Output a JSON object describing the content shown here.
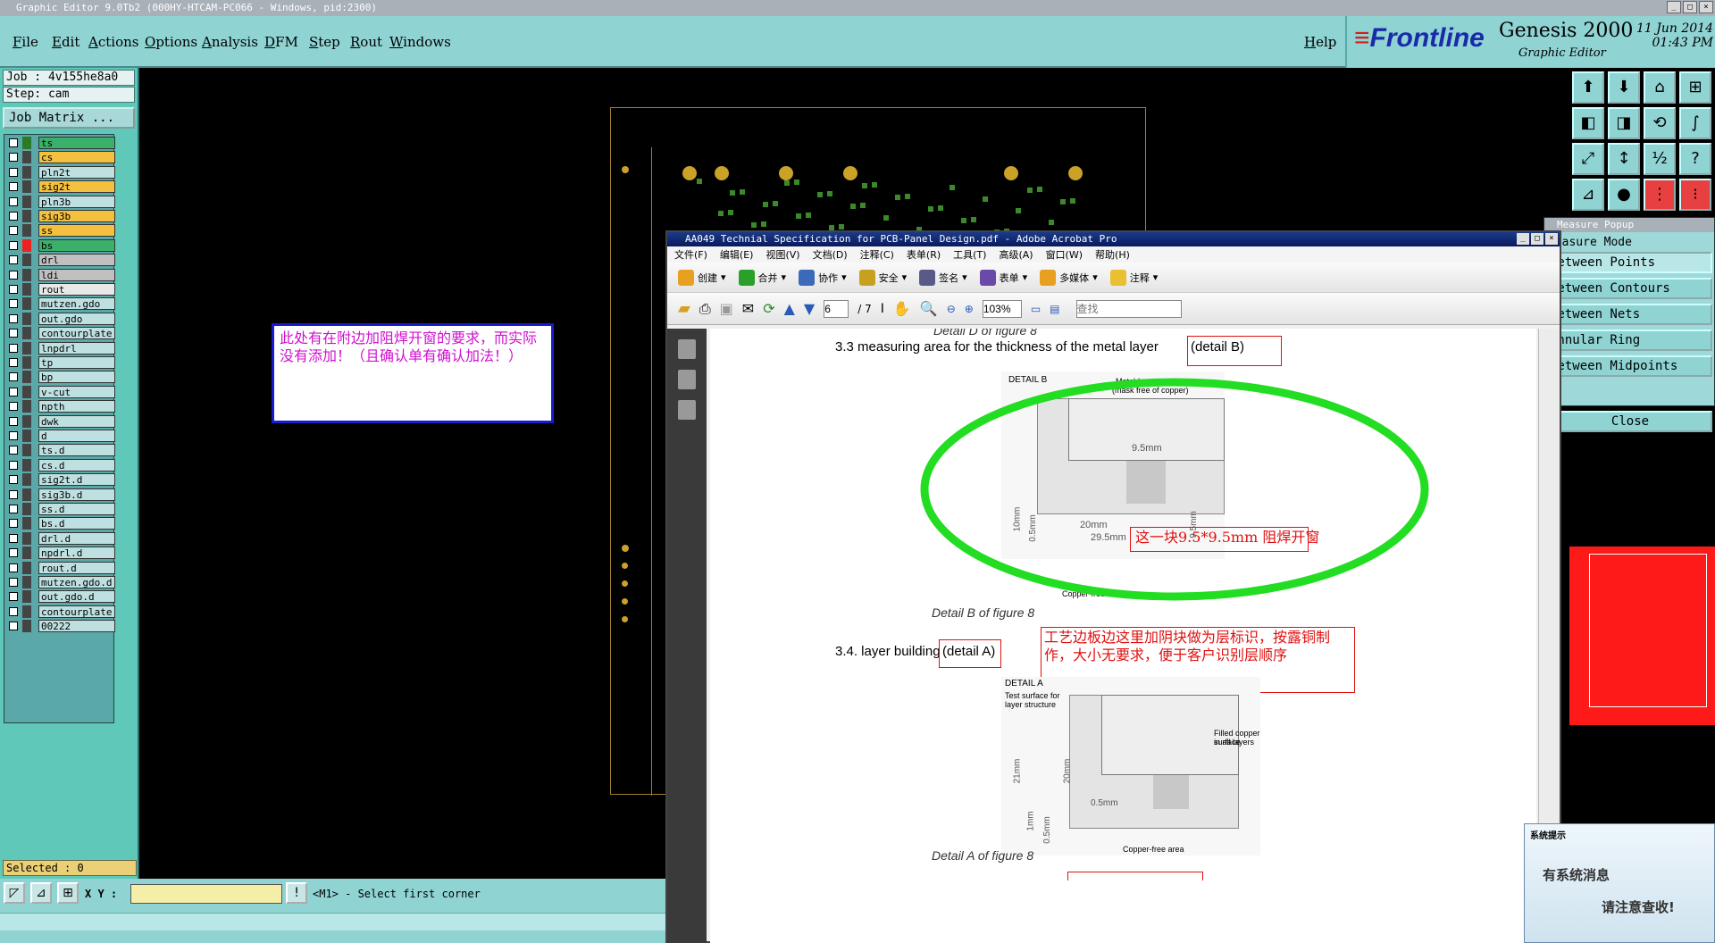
{
  "window": {
    "title": "Graphic Editor 9.0Tb2 (000HY-HTCAM-PC066 - Windows, pid:2300)"
  },
  "menu": [
    "File",
    "Edit",
    "Actions",
    "Options",
    "Analysis",
    "DFM",
    "Step",
    "Rout",
    "Windows"
  ],
  "help": "Help",
  "brand": {
    "logo": "Frontline",
    "product": "Genesis 2000",
    "subtitle": "Graphic Editor",
    "date": "11 Jun 2014",
    "time": "01:43 PM"
  },
  "job": {
    "job": "Job : 4v155he8a0",
    "step": "Step: cam",
    "matrix_button": "Job Matrix ..."
  },
  "layers": [
    {
      "name": "ts",
      "color": "#3ab06a",
      "swatch": "#2a7a2a"
    },
    {
      "name": "cs",
      "color": "#f4c040",
      "swatch": "#444"
    },
    {
      "name": "pln2t",
      "color": "#bfe0e0",
      "swatch": "#444"
    },
    {
      "name": "sig2t",
      "color": "#f4c040",
      "swatch": "#444"
    },
    {
      "name": "pln3b",
      "color": "#bfe0e0",
      "swatch": "#444"
    },
    {
      "name": "sig3b",
      "color": "#f4c040",
      "swatch": "#444"
    },
    {
      "name": "ss",
      "color": "#f4c040",
      "swatch": "#444"
    },
    {
      "name": "bs",
      "color": "#3ab06a",
      "swatch": "#ee2020"
    },
    {
      "name": "drl",
      "color": "#c0c0c0",
      "swatch": "#444"
    },
    {
      "name": "ldi",
      "color": "#c0c0c0",
      "swatch": "#444"
    },
    {
      "name": "rout",
      "color": "#e8e8e8",
      "swatch": "#444"
    },
    {
      "name": "mutzen.gdo",
      "color": "#bfe0e0",
      "swatch": "#444"
    },
    {
      "name": "out.gdo",
      "color": "#bfe0e0",
      "swatch": "#444"
    },
    {
      "name": "contourplate",
      "color": "#bfe0e0",
      "swatch": "#444"
    },
    {
      "name": "lnpdrl",
      "color": "#bfe0e0",
      "swatch": "#444"
    },
    {
      "name": "tp",
      "color": "#bfe0e0",
      "swatch": "#444"
    },
    {
      "name": "bp",
      "color": "#bfe0e0",
      "swatch": "#444"
    },
    {
      "name": "v-cut",
      "color": "#bfe0e0",
      "swatch": "#444"
    },
    {
      "name": "npth",
      "color": "#bfe0e0",
      "swatch": "#444"
    },
    {
      "name": "dwk",
      "color": "#bfe0e0",
      "swatch": "#444"
    },
    {
      "name": "d",
      "color": "#bfe0e0",
      "swatch": "#444"
    },
    {
      "name": "ts.d",
      "color": "#bfe0e0",
      "swatch": "#444"
    },
    {
      "name": "cs.d",
      "color": "#bfe0e0",
      "swatch": "#444"
    },
    {
      "name": "sig2t.d",
      "color": "#bfe0e0",
      "swatch": "#444"
    },
    {
      "name": "sig3b.d",
      "color": "#bfe0e0",
      "swatch": "#444"
    },
    {
      "name": "ss.d",
      "color": "#bfe0e0",
      "swatch": "#444"
    },
    {
      "name": "bs.d",
      "color": "#bfe0e0",
      "swatch": "#444"
    },
    {
      "name": "drl.d",
      "color": "#bfe0e0",
      "swatch": "#444"
    },
    {
      "name": "npdrl.d",
      "color": "#bfe0e0",
      "swatch": "#444"
    },
    {
      "name": "rout.d",
      "color": "#bfe0e0",
      "swatch": "#444"
    },
    {
      "name": "mutzen.gdo.d",
      "color": "#bfe0e0",
      "swatch": "#444"
    },
    {
      "name": "out.gdo.d",
      "color": "#bfe0e0",
      "swatch": "#444"
    },
    {
      "name": "contourplate.",
      "color": "#bfe0e0",
      "swatch": "#444"
    },
    {
      "name": "00222",
      "color": "#bfe0e0",
      "swatch": "#444"
    }
  ],
  "selected": "Selected : 0",
  "xy_label": "X Y :",
  "prompt": "<M1> - Select first corner",
  "canvas_note": "此处有在附边加阻焊开窗的要求，而实际没有添加！（且确认单有确认加法！）",
  "acrobat": {
    "title": "AA049 Technial Specification for PCB-Panel Design.pdf - Adobe Acrobat Pro",
    "menu": [
      "文件(F)",
      "编辑(E)",
      "视图(V)",
      "文档(D)",
      "注释(C)",
      "表单(R)",
      "工具(T)",
      "高级(A)",
      "窗口(W)",
      "帮助(H)"
    ],
    "toolbar": [
      "创建",
      "合并",
      "协作",
      "安全",
      "签名",
      "表单",
      "多媒体",
      "注释"
    ],
    "page": "6",
    "pages": "/ 7",
    "zoom": "103%",
    "search_placeholder": "查找"
  },
  "doc": {
    "caption_d": "Detail D of figure 8",
    "h33": "3.3 measuring area for the thickness of the metal layer",
    "h33_detail": "(detail B)",
    "detail_b": "DETAIL B",
    "coupon": "Metal-layer-coupon",
    "coupon2": "(mask free of copper)",
    "d95": "9.5mm",
    "d20": "20mm",
    "d295": "29.5mm",
    "d10": "10mm",
    "d05": "0.5mm",
    "d95v": "9.5mm",
    "copper_free": "Copper-free area",
    "caption_b": "Detail B of figure 8",
    "note_b": "这一块9.5*9.5mm 阻焊开窗",
    "h34": "3.4. layer building",
    "h34_detail": "(detail A)",
    "note_a": "工艺边板边这里加阴块做为层标识，按露铜制作，大小无要求，便于客户识别层顺序",
    "detail_a": "DETAIL A",
    "test_surface": "Test surface for",
    "test_surface2": "layer structure",
    "filled": "Filled copper surface",
    "filled2": "in all layers",
    "d21": "21mm",
    "d20a": "20mm",
    "d1": "1mm",
    "d05a": "0.5mm",
    "d05b": "0.5mm",
    "copper_free_a": "Copper-free area",
    "caption_a": "Detail A of figure 8"
  },
  "measure": {
    "title": "Measure Popup",
    "mode": "Measure Mode",
    "items": [
      "Between Points",
      "Between Contours",
      "Between Nets",
      "Annular Ring",
      "Between Midpoints"
    ],
    "close": "Close"
  },
  "sysnote": {
    "title": "系统提示",
    "line1": "有系统消息",
    "line2": "请注意查收!"
  }
}
